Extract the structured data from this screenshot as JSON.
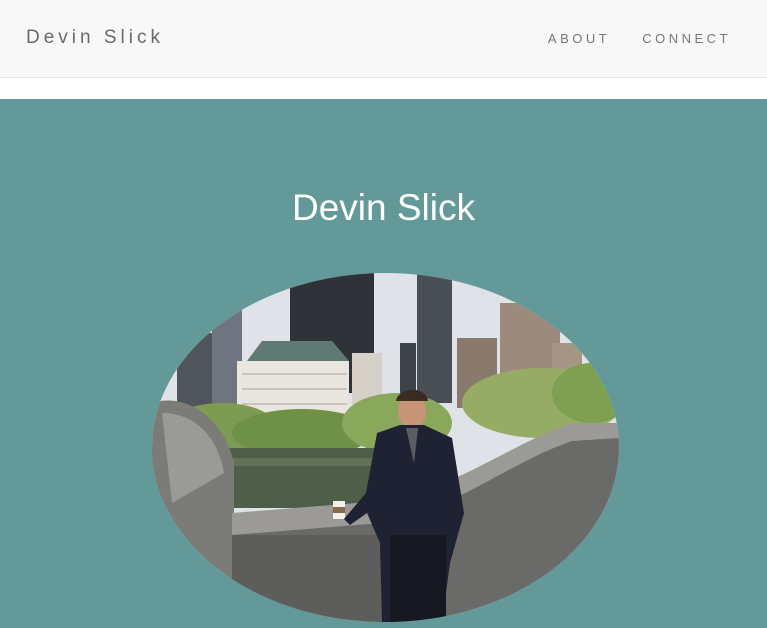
{
  "navbar": {
    "brand": "Devin Slick",
    "links": [
      {
        "label": "ABOUT"
      },
      {
        "label": "CONNECT"
      }
    ]
  },
  "hero": {
    "title": "Devin Slick",
    "background_color": "#639a99",
    "portrait_icon": "profile-photo"
  }
}
